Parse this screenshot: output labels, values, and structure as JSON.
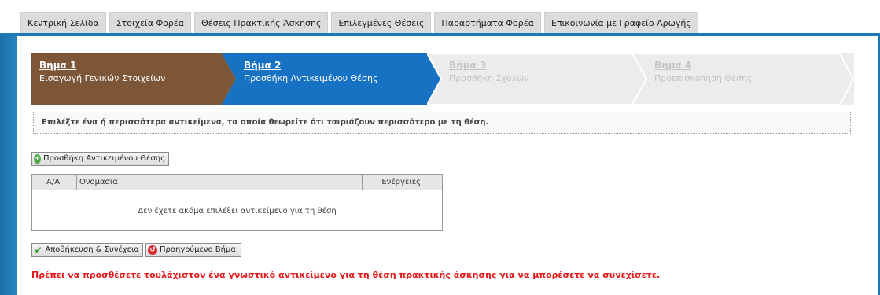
{
  "nav": {
    "tabs": [
      {
        "label": "Κεντρική Σελίδα"
      },
      {
        "label": "Στοιχεία Φορέα"
      },
      {
        "label": "Θέσεις Πρακτικής Άσκησης"
      },
      {
        "label": "Επιλεγμένες Θέσεις"
      },
      {
        "label": "Παραρτήματα Φορέα"
      },
      {
        "label": "Επικοινωνία με Γραφείο Αρωγής"
      }
    ]
  },
  "wizard": {
    "steps": [
      {
        "number": "Βήμα 1",
        "title": "Εισαγωγή Γενικών Στοιχείων",
        "state": "completed",
        "color": "#7d5537"
      },
      {
        "number": "Βήμα 2",
        "title": "Προσθήκη Αντικειμένου Θέσης",
        "state": "active",
        "color": "#1872c4"
      },
      {
        "number": "Βήμα 3",
        "title": "Προσθήκη Σχολών",
        "state": "pending",
        "color": "#ececec"
      },
      {
        "number": "Βήμα 4",
        "title": "Προεπισκόπηση Θέσης",
        "state": "pending",
        "color": "#ececec"
      }
    ]
  },
  "instructions": "Επιλέξτε ένα ή περισσότερα αντικείμενα, τα οποία θεωρείτε ότι ταιριάζουν περισσότερο με τη θέση.",
  "buttons": {
    "add_object": "Προσθήκη Αντικειμένου Θέσης",
    "save_continue": "Αποθήκευση & Συνέχεια",
    "previous_step": "Προηγούμενο Βήμα"
  },
  "grid": {
    "columns": [
      "Α/Α",
      "Ονομασία",
      "Ενέργειες"
    ],
    "empty_message": "Δεν έχετε ακόμα επιλέξει αντικείμενο για τη θέση"
  },
  "error_message": "Πρέπει να προσθέσετε τουλάχιστον ένα γνωστικό αντικείμενο για τη θέση πρακτικής άσκησης για να μπορέσετε να συνεχίσετε.",
  "colors": {
    "accent_blue": "#1b79b4",
    "error_red": "#e21a1a"
  }
}
